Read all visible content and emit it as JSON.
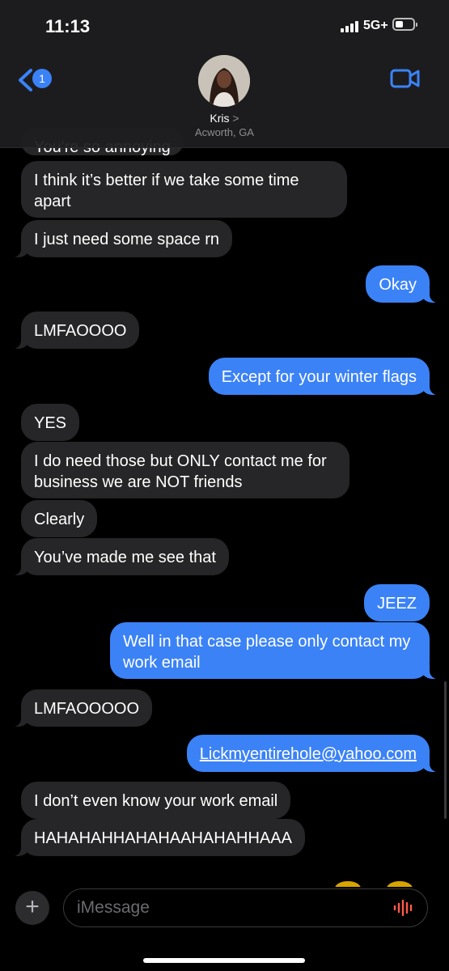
{
  "status": {
    "time": "11:13",
    "network": "5G+"
  },
  "header": {
    "back_badge": "1",
    "contact_name": "Kris",
    "contact_chevron": ">",
    "contact_location": "Acworth, GA"
  },
  "messages": [
    {
      "dir": "in",
      "text": "You're so annoying"
    },
    {
      "dir": "in",
      "text": "I think it’s better if we take some time apart"
    },
    {
      "dir": "in",
      "text": "I just need some space rn"
    },
    {
      "dir": "out",
      "text": "Okay"
    },
    {
      "dir": "in",
      "text": "LMFAOOOO"
    },
    {
      "dir": "out",
      "text": "Except for your winter flags"
    },
    {
      "dir": "in",
      "text": "YES"
    },
    {
      "dir": "in",
      "text": "I do need those but ONLY contact me for business we are NOT friends"
    },
    {
      "dir": "in",
      "text": "Clearly"
    },
    {
      "dir": "in",
      "text": "You’ve made me see that"
    },
    {
      "dir": "out",
      "text": "JEEZ"
    },
    {
      "dir": "out",
      "text": "Well in that case please only contact my work email"
    },
    {
      "dir": "in",
      "text": "LMFAOOOOO"
    },
    {
      "dir": "out",
      "text": "Lickmyentirehole@yahoo.com"
    },
    {
      "dir": "in",
      "text": "I don’t even know your work email"
    },
    {
      "dir": "in",
      "text": "HAHAHAHHAHAHAAHAHAHHAAA"
    }
  ],
  "input": {
    "placeholder": "iMessage",
    "add_icon": "plus-icon",
    "mic_icon": "audio-waveform-icon"
  },
  "colors": {
    "outgoing": "#3b82f6",
    "incoming": "#262628",
    "background": "#000000"
  }
}
